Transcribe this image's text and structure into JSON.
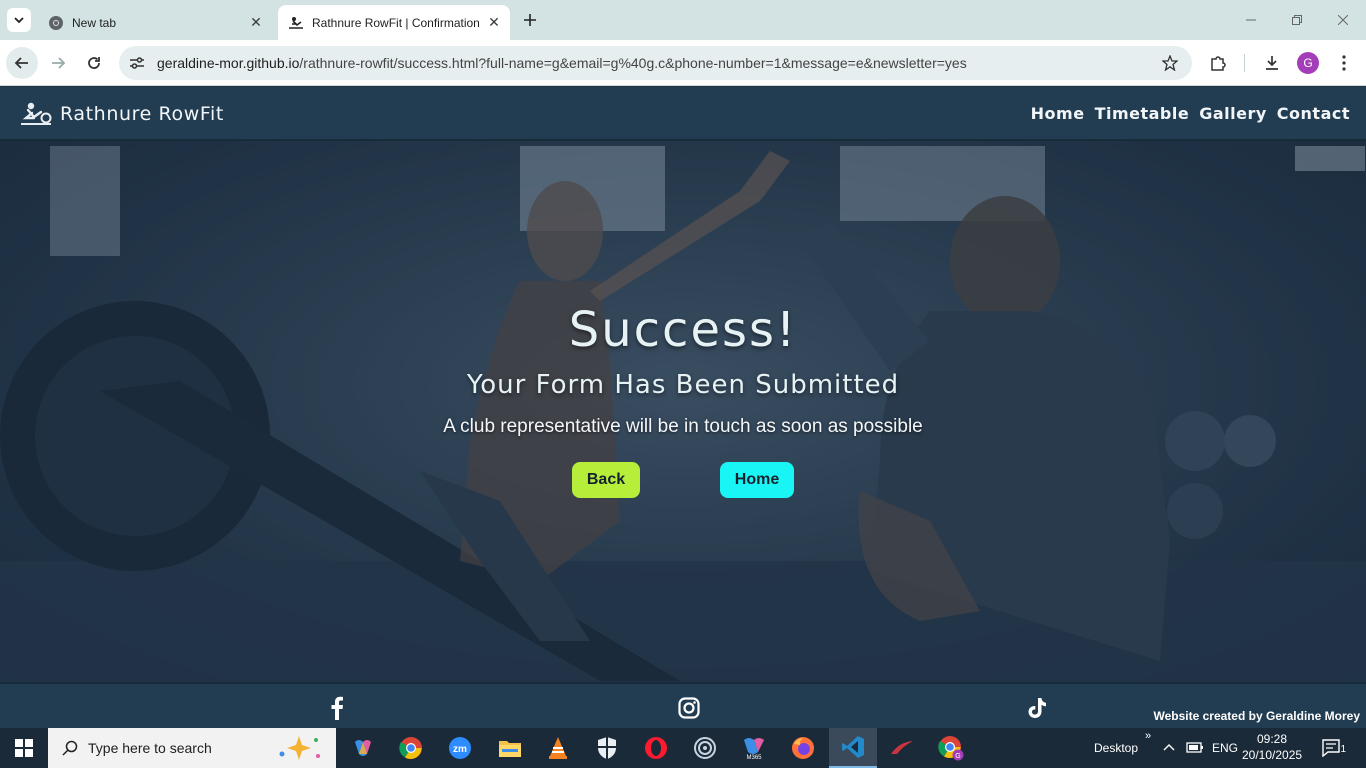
{
  "browser": {
    "tabs": [
      {
        "title": "New tab",
        "active": false,
        "favicon": "chrome-icon"
      },
      {
        "title": "Rathnure RowFit | Confirmation",
        "active": true,
        "favicon": "rower-icon"
      }
    ],
    "url_host": "geraldine-mor.github.io",
    "url_path": "/rathnure-rowfit/success.html?full-name=g&email=g%40g.c&phone-number=1&message=e&newsletter=yes",
    "profile_initial": "G"
  },
  "site": {
    "brand": "Rathnure RowFit",
    "nav": [
      "Home",
      "Timetable",
      "Gallery",
      "Contact"
    ],
    "hero": {
      "title": "Success!",
      "subtitle": "Your Form Has Been Submitted",
      "message": "A club representative will be in touch as soon as possible",
      "back_label": "Back",
      "home_label": "Home"
    },
    "footer": {
      "social": [
        "facebook-icon",
        "instagram-icon",
        "tiktok-icon"
      ],
      "credit": "Website created by Geraldine Morey"
    },
    "colors": {
      "nav_bg": "#223d52",
      "back_button": "#b5ef3a",
      "home_button": "#19f5f5"
    }
  },
  "taskbar": {
    "search_placeholder": "Type here to search",
    "desktop_label": "Desktop",
    "language": "ENG",
    "time": "09:28",
    "date": "20/10/2025",
    "notification_count": "1",
    "apps": [
      "copilot-icon",
      "chrome-icon",
      "zoom-icon",
      "file-explorer-icon",
      "vlc-icon",
      "security-icon",
      "opera-icon",
      "app-icon",
      "m365-icon",
      "firefox-icon",
      "vscode-icon",
      "app-icon",
      "chrome-profile-icon"
    ]
  }
}
